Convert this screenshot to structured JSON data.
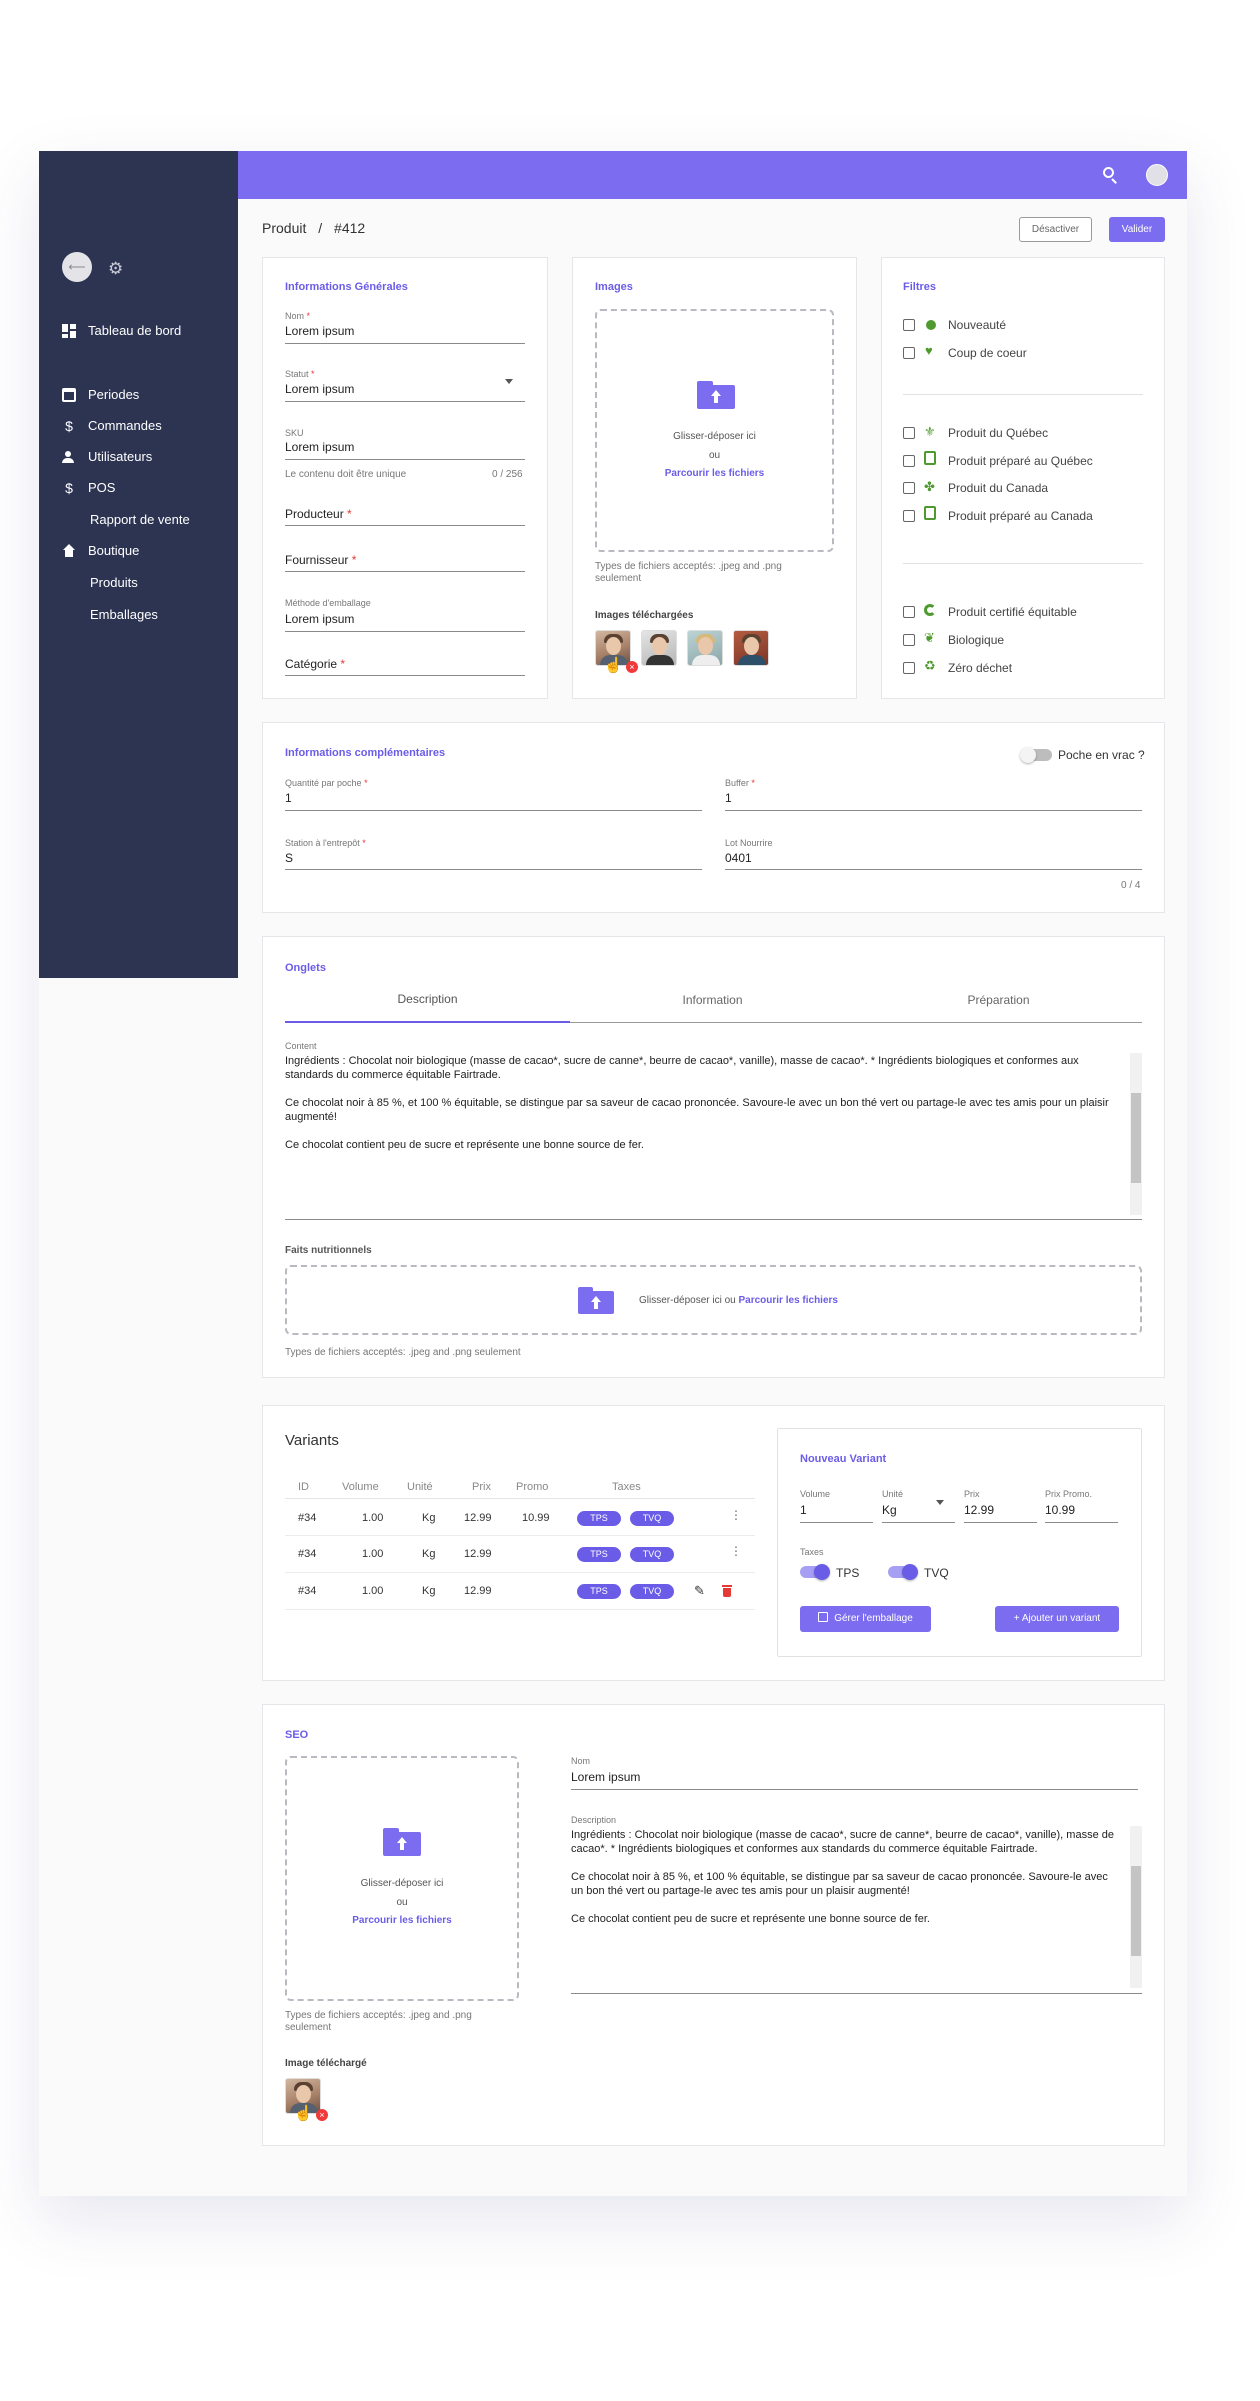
{
  "colors": {
    "primary": "#7b6cf0",
    "sidebar": "#2d3452",
    "danger": "#f03a3a",
    "green": "#4f9a2e"
  },
  "sidebar": {
    "dashboard": "Tableau de bord",
    "items": [
      {
        "label": "Periodes",
        "icon": "calendar-icon"
      },
      {
        "label": "Commandes",
        "icon": "dollar-icon"
      },
      {
        "label": "Utilisateurs",
        "icon": "users-icon"
      },
      {
        "label": "POS",
        "icon": "dollar-icon"
      },
      {
        "label": "Rapport de vente",
        "icon": ""
      },
      {
        "label": "Boutique",
        "icon": "home-icon"
      },
      {
        "label": "Produits",
        "icon": ""
      },
      {
        "label": "Emballages",
        "icon": ""
      }
    ]
  },
  "header": {
    "breadcrumb_root": "Produit",
    "breadcrumb_sep": "/",
    "breadcrumb_id": "#412",
    "deactivate": "Désactiver",
    "validate": "Valider"
  },
  "general": {
    "title": "Informations Générales",
    "name_label": "Nom",
    "name_value": "Lorem ipsum",
    "status_label": "Statut",
    "status_value": "Lorem ipsum",
    "sku_label": "SKU",
    "sku_value": "Lorem ipsum",
    "sku_hint": "Le contenu doit être unique",
    "sku_counter": "0 / 256",
    "producer": "Producteur",
    "supplier": "Fournisseur",
    "packaging_label": "Méthode d'emballage",
    "packaging_value": "Lorem ipsum",
    "category": "Catégorie",
    "required": "*"
  },
  "images": {
    "title": "Images",
    "drop": "Glisser-déposer ici",
    "or": "ou",
    "browse": "Parcourir les fichiers",
    "accepted": "Types de fichiers acceptés: .jpeg and .png seulement",
    "uploaded_title": "Images téléchargées",
    "remove": "×"
  },
  "filters": {
    "title": "Filtres",
    "group1": [
      "Nouveauté",
      "Coup de coeur"
    ],
    "group2": [
      "Produit du Québec",
      "Produit préparé au Québec",
      "Produit du Canada",
      "Produit préparé au Canada"
    ],
    "group3": [
      "Produit certifié équitable",
      "Biologique",
      "Zéro déchet"
    ]
  },
  "complementary": {
    "title": "Informations complémentaires",
    "bulk_toggle": "Poche en vrac ?",
    "qty_label": "Quantité par poche",
    "qty_value": "1",
    "buffer_label": "Buffer",
    "buffer_value": "1",
    "station_label": "Station à l'entrepôt",
    "station_value": "S",
    "lot_label": "Lot Nourrire",
    "lot_value": "0401",
    "counter": "0 / 4"
  },
  "tabs_section": {
    "title": "Onglets",
    "tabs": [
      "Description",
      "Information",
      "Préparation"
    ],
    "content_label": "Content",
    "content_p1": "Ingrédients : Chocolat noir biologique (masse de cacao*, sucre de canne*, beurre de cacao*, vanille), masse de cacao*. * Ingrédients biologiques et conformes aux standards du commerce équitable Fairtrade.",
    "content_p2": "Ce chocolat noir à 85 %, et 100 % équitable, se distingue par sa saveur de cacao prononcée. Savoure-le avec un bon thé vert ou partage-le avec tes amis pour un plaisir augmenté!",
    "content_p3": "Ce chocolat contient peu de sucre et représente une bonne source de fer.",
    "nutrition_title": "Faits nutritionnels",
    "nutrition_drop": "Glisser-déposer ici ou ",
    "nutrition_browse": "Parcourir les fichiers",
    "nutrition_accepted": "Types de fichiers acceptés: .jpeg and .png seulement"
  },
  "variants": {
    "title": "Variants",
    "headers": [
      "ID",
      "Volume",
      "Unité",
      "Prix",
      "Promo",
      "Taxes"
    ],
    "rows": [
      {
        "id": "#34",
        "volume": "1.00",
        "unit": "Kg",
        "price": "12.99",
        "promo": "10.99",
        "tax1": "TPS",
        "tax2": "TVQ"
      },
      {
        "id": "#34",
        "volume": "1.00",
        "unit": "Kg",
        "price": "12.99",
        "promo": "",
        "tax1": "TPS",
        "tax2": "TVQ"
      },
      {
        "id": "#34",
        "volume": "1.00",
        "unit": "Kg",
        "price": "12.99",
        "promo": "",
        "tax1": "TPS",
        "tax2": "TVQ"
      }
    ],
    "new_title": "Nouveau Variant",
    "volume_label": "Volume",
    "volume_value": "1",
    "unit_label": "Unité",
    "unit_value": "Kg",
    "price_label": "Prix",
    "price_value": "12.99",
    "promo_label": "Prix Promo.",
    "promo_value": "10.99",
    "taxes_label": "Taxes",
    "tps": "TPS",
    "tvq": "TVQ",
    "manage_packaging": "Gérer l'emballage",
    "add_variant": "+ Ajouter un variant"
  },
  "seo": {
    "title": "SEO",
    "drop": "Glisser-déposer ici",
    "or": "ou",
    "browse": "Parcourir les fichiers",
    "accepted": "Types de fichiers acceptés: .jpeg and .png seulement",
    "uploaded_title": "Image téléchargé",
    "name_label": "Nom",
    "name_value": "Lorem ipsum",
    "desc_label": "Description",
    "desc_p1": "Ingrédients : Chocolat noir biologique (masse de cacao*, sucre de canne*, beurre de cacao*, vanille), masse de cacao*. * Ingrédients biologiques et conformes aux standards du commerce équitable Fairtrade.",
    "desc_p2": "Ce chocolat noir à 85 %, et 100 % équitable, se distingue par sa saveur de cacao prononcée. Savoure-le avec un bon thé vert ou partage-le avec tes amis pour un plaisir augmenté!",
    "desc_p3": "Ce chocolat contient peu de sucre et représente une bonne source de fer."
  }
}
